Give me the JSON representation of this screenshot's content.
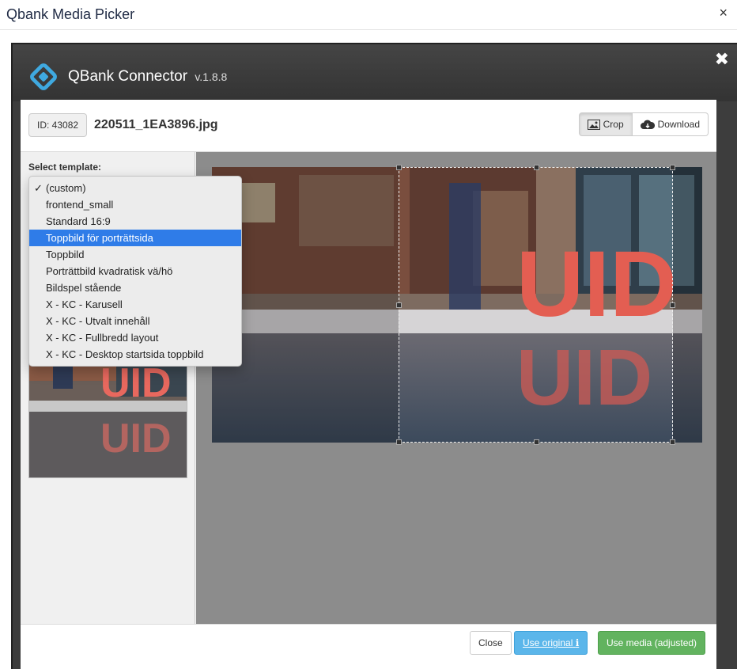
{
  "outer": {
    "title": "Qbank Media Picker",
    "close_glyph": "×"
  },
  "connector": {
    "name": "QBank Connector",
    "version": "v.1.8.8",
    "close_glyph": "✖"
  },
  "toolbar": {
    "id_label": "ID: 43082",
    "filename": "220511_1EA3896.jpg",
    "crop_label": "Crop",
    "download_label": "Download"
  },
  "sidebar": {
    "select_label": "Select template:"
  },
  "templates": {
    "check_glyph": "✓",
    "items": [
      "(custom)",
      "frontend_small",
      "Standard 16:9",
      "Toppbild för porträttsida",
      "Toppbild",
      "Porträttbild kvadratisk vä/hö",
      "Bildspel stående",
      "X - KC - Karusell",
      "X - KC - Utvalt innehåll",
      "X - KC - Fullbredd layout",
      "X - KC - Desktop startsida toppbild"
    ],
    "checked_index": 0,
    "highlighted_index": 3
  },
  "image": {
    "sign_text": "UID"
  },
  "footer": {
    "close_label": "Close",
    "use_original_label": "Use original",
    "use_media_label": "Use media (adjusted)",
    "info_glyph": "ℹ"
  },
  "colors": {
    "accent_blue": "#2f7ce8",
    "info_button": "#5bb6ea",
    "success_button": "#62b35f",
    "logo_blue": "#3fa9e0"
  }
}
